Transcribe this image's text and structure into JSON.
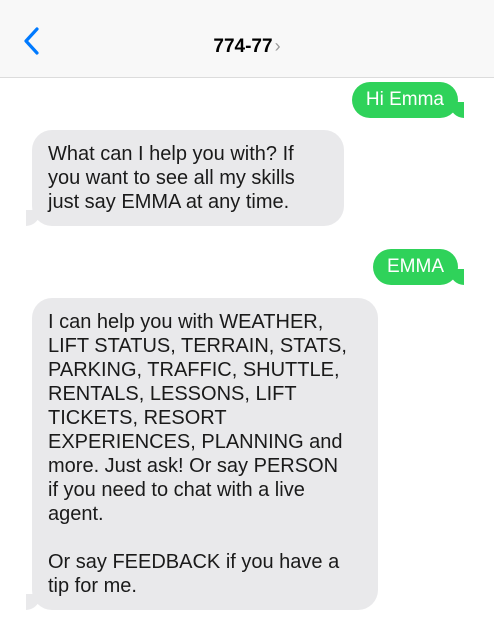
{
  "header": {
    "contact_name": "774-77",
    "chevron": "›",
    "back_icon": "chevron-left-icon"
  },
  "messages": [
    {
      "direction": "sent",
      "paragraphs": [
        "Hi Emma"
      ]
    },
    {
      "direction": "received",
      "paragraphs": [
        "What can I help you with? If\nyou want to see all my skills\njust say EMMA at any time."
      ]
    },
    {
      "direction": "sent",
      "paragraphs": [
        "EMMA"
      ]
    },
    {
      "direction": "received",
      "paragraphs": [
        "I can help you with WEATHER,\nLIFT STATUS, TERRAIN, STATS,\nPARKING, TRAFFIC, SHUTTLE,\nRENTALS, LESSONS, LIFT\nTICKETS, RESORT\nEXPERIENCES, PLANNING and\nmore. Just ask! Or say PERSON\nif you need to chat with a live\nagent.",
        "Or say FEEDBACK if you have a\ntip for me."
      ]
    }
  ],
  "colors": {
    "accent": "#007aff",
    "sent_bubble": "#2fd25a",
    "received_bubble": "#e9e9eb",
    "header_bg": "#f8f8f8"
  }
}
